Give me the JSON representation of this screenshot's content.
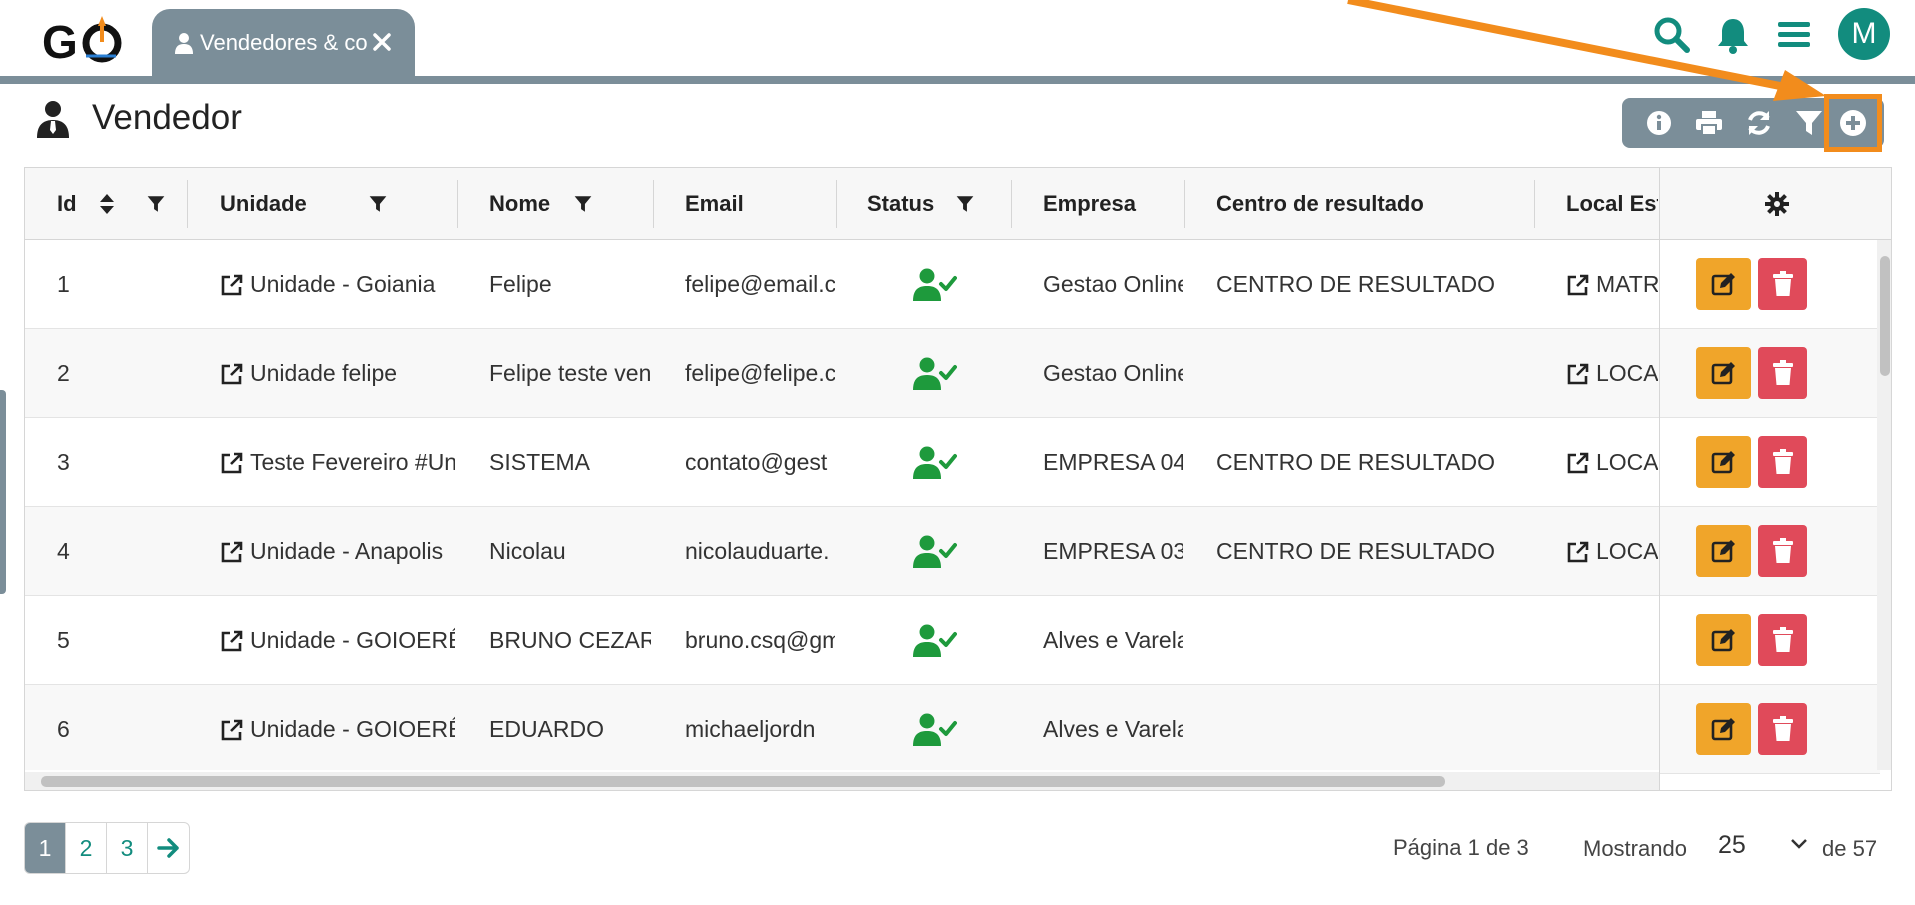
{
  "app": {
    "logo_text": "GO",
    "tab_label": "Vendedores & co",
    "avatar_initial": "M",
    "accent_color": "#128c7e",
    "bar_color": "#7b8e99",
    "annotation_color": "#f28c1c"
  },
  "page": {
    "title": "Vendedor",
    "toolbar_icons": [
      "info-icon",
      "print-icon",
      "refresh-icon",
      "filter-icon",
      "add-icon"
    ]
  },
  "table": {
    "headers": {
      "id": "Id",
      "unidade": "Unidade",
      "nome": "Nome",
      "email": "Email",
      "status": "Status",
      "empresa": "Empresa",
      "centro": "Centro de resultado",
      "local": "Local Est"
    },
    "rows": [
      {
        "id": "1",
        "unidade": "Unidade - Goiania",
        "nome": "Felipe",
        "email": "felipe@email.c",
        "empresa": "Gestao Online",
        "centro": "CENTRO DE RESULTADO",
        "local": "MATRIZ"
      },
      {
        "id": "2",
        "unidade": "Unidade felipe",
        "nome": "Felipe teste ven",
        "email": "felipe@felipe.c",
        "empresa": "Gestao Online",
        "centro": "",
        "local": "LOCAL"
      },
      {
        "id": "3",
        "unidade": "Teste Fevereiro #Un",
        "nome": "SISTEMA",
        "email": "contato@gest",
        "empresa": "EMPRESA 04",
        "centro": "CENTRO DE RESULTADO",
        "local": "LOCAL"
      },
      {
        "id": "4",
        "unidade": "Unidade - Anapolis",
        "nome": "Nicolau",
        "email": "nicolauduarte.",
        "empresa": "EMPRESA 03",
        "centro": "CENTRO DE RESULTADO",
        "local": "LOCAL"
      },
      {
        "id": "5",
        "unidade": "Unidade - GOIOERÊ",
        "nome": "BRUNO CEZAR",
        "email": "bruno.csq@gm",
        "empresa": "Alves e Varela",
        "centro": "",
        "local": ""
      },
      {
        "id": "6",
        "unidade": "Unidade - GOIOERÊ",
        "nome": "EDUARDO",
        "email": "michaeljordn",
        "empresa": "Alves e Varela",
        "centro": "",
        "local": ""
      }
    ]
  },
  "pagination": {
    "pages": [
      "1",
      "2",
      "3"
    ],
    "current": "1",
    "page_info": "Página 1 de 3",
    "showing_label": "Mostrando",
    "per_page": "25",
    "total_label": "de 57"
  }
}
